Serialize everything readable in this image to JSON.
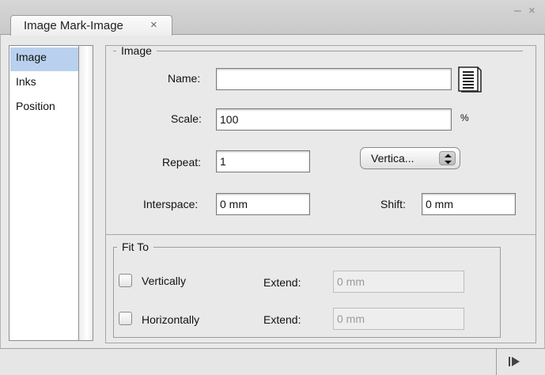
{
  "window": {
    "tab_title": "Image Mark-Image",
    "tab_close_glyph": "×",
    "minimize_glyph": "–",
    "close_glyph": "×"
  },
  "sidebar": {
    "items": [
      {
        "label": "Image",
        "selected": true
      },
      {
        "label": "Inks",
        "selected": false
      },
      {
        "label": "Position",
        "selected": false
      }
    ]
  },
  "image_group": {
    "legend": "Image",
    "name_label": "Name:",
    "name_value": "",
    "scale_label": "Scale:",
    "scale_value": "100",
    "scale_unit": "%",
    "repeat_label": "Repeat:",
    "repeat_value": "1",
    "direction_select": "Vertica...",
    "interspace_label": "Interspace:",
    "interspace_value": "0 mm",
    "shift_label": "Shift:",
    "shift_value": "0 mm"
  },
  "fit_to_group": {
    "legend": "Fit To",
    "vertically_label": "Vertically",
    "vertically_checked": false,
    "vertical_extend_label": "Extend:",
    "vertical_extend_value": "0 mm",
    "horizontally_label": "Horizontally",
    "horizontally_checked": false,
    "horizontal_extend_label": "Extend:",
    "horizontal_extend_value": "0 mm"
  },
  "icons": {
    "document": "document-list-icon",
    "select_arrows": "up-down-arrows-icon",
    "play": "play-step-icon"
  },
  "colors": {
    "selection": "#b9d1ee",
    "panel": "#e9e9e9"
  }
}
